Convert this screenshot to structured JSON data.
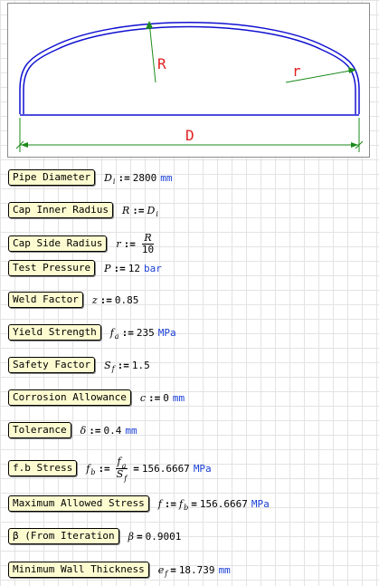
{
  "diagram": {
    "labels": {
      "R": "R",
      "r": "r",
      "D": "D"
    },
    "colors": {
      "outline": "#1010d0",
      "dimension": "#1a8a1a",
      "label": "#e02020"
    }
  },
  "rows": [
    {
      "label": "Pipe Diameter",
      "var": "D",
      "sub": "i",
      "op": ":=",
      "value": "2800",
      "unit": "mm"
    },
    {
      "label": "Cap Inner Radius",
      "var": "R",
      "op": ":=",
      "rhs_var": "D",
      "rhs_sub": "i"
    },
    {
      "label": "Cap Side Radius",
      "var": "r",
      "op": ":=",
      "frac_num": "R",
      "frac_den": "10"
    },
    {
      "label": "Test Pressure",
      "var": "P",
      "op": ":=",
      "value": "12",
      "unit": "bar"
    },
    {
      "label": "Weld Factor",
      "var": "z",
      "op": ":=",
      "value": "0.85"
    },
    {
      "label": "Yield Strength",
      "var": "f",
      "sub": "a",
      "op": ":=",
      "value": "235",
      "unit": "MPa"
    },
    {
      "label": "Safety Factor",
      "var": "S",
      "sub": "f",
      "op": ":=",
      "value": "1.5"
    },
    {
      "label": "Corrosion Allowance",
      "var": "c",
      "op": ":=",
      "value": "0",
      "unit": "mm"
    },
    {
      "label": "Tolerance",
      "var": "δ",
      "op": ":=",
      "value": "0.4",
      "unit": "mm"
    },
    {
      "label": "f.b Stress",
      "var": "f",
      "sub": "b",
      "op": ":=",
      "frac_num_var": "f",
      "frac_num_sub": "a",
      "frac_den_var": "S",
      "frac_den_sub": "f",
      "eq": "=",
      "value": "156.6667",
      "unit": "MPa"
    },
    {
      "label": "Maximum Allowed Stress",
      "var": "f",
      "op": ":=",
      "rhs_var": "f",
      "rhs_sub": "b",
      "eq": "=",
      "value": "156.6667",
      "unit": "MPa"
    },
    {
      "label": "β (From Iteration",
      "var": "β",
      "eq": "=",
      "value": "0.9001"
    },
    {
      "label": "Minimum Wall Thickness",
      "var": "e",
      "sub": "f",
      "eq": "=",
      "value": "18.739",
      "unit": "mm"
    }
  ]
}
